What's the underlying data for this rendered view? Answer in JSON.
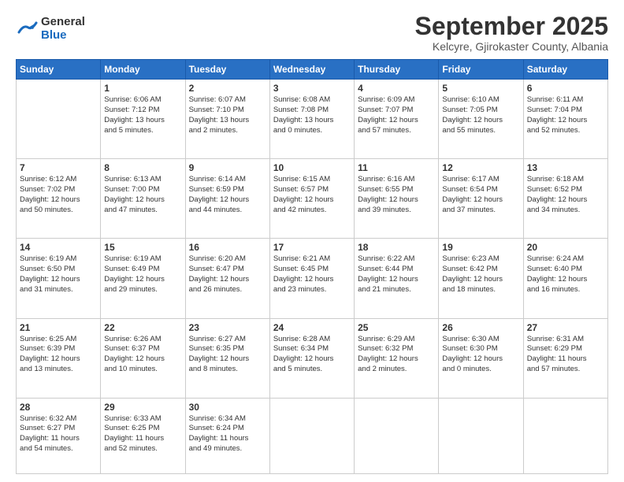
{
  "logo": {
    "general": "General",
    "blue": "Blue"
  },
  "header": {
    "month": "September 2025",
    "location": "Kelcyre, Gjirokaster County, Albania"
  },
  "weekdays": [
    "Sunday",
    "Monday",
    "Tuesday",
    "Wednesday",
    "Thursday",
    "Friday",
    "Saturday"
  ],
  "weeks": [
    [
      {
        "day": "",
        "info": ""
      },
      {
        "day": "1",
        "info": "Sunrise: 6:06 AM\nSunset: 7:12 PM\nDaylight: 13 hours\nand 5 minutes."
      },
      {
        "day": "2",
        "info": "Sunrise: 6:07 AM\nSunset: 7:10 PM\nDaylight: 13 hours\nand 2 minutes."
      },
      {
        "day": "3",
        "info": "Sunrise: 6:08 AM\nSunset: 7:08 PM\nDaylight: 13 hours\nand 0 minutes."
      },
      {
        "day": "4",
        "info": "Sunrise: 6:09 AM\nSunset: 7:07 PM\nDaylight: 12 hours\nand 57 minutes."
      },
      {
        "day": "5",
        "info": "Sunrise: 6:10 AM\nSunset: 7:05 PM\nDaylight: 12 hours\nand 55 minutes."
      },
      {
        "day": "6",
        "info": "Sunrise: 6:11 AM\nSunset: 7:04 PM\nDaylight: 12 hours\nand 52 minutes."
      }
    ],
    [
      {
        "day": "7",
        "info": "Sunrise: 6:12 AM\nSunset: 7:02 PM\nDaylight: 12 hours\nand 50 minutes."
      },
      {
        "day": "8",
        "info": "Sunrise: 6:13 AM\nSunset: 7:00 PM\nDaylight: 12 hours\nand 47 minutes."
      },
      {
        "day": "9",
        "info": "Sunrise: 6:14 AM\nSunset: 6:59 PM\nDaylight: 12 hours\nand 44 minutes."
      },
      {
        "day": "10",
        "info": "Sunrise: 6:15 AM\nSunset: 6:57 PM\nDaylight: 12 hours\nand 42 minutes."
      },
      {
        "day": "11",
        "info": "Sunrise: 6:16 AM\nSunset: 6:55 PM\nDaylight: 12 hours\nand 39 minutes."
      },
      {
        "day": "12",
        "info": "Sunrise: 6:17 AM\nSunset: 6:54 PM\nDaylight: 12 hours\nand 37 minutes."
      },
      {
        "day": "13",
        "info": "Sunrise: 6:18 AM\nSunset: 6:52 PM\nDaylight: 12 hours\nand 34 minutes."
      }
    ],
    [
      {
        "day": "14",
        "info": "Sunrise: 6:19 AM\nSunset: 6:50 PM\nDaylight: 12 hours\nand 31 minutes."
      },
      {
        "day": "15",
        "info": "Sunrise: 6:19 AM\nSunset: 6:49 PM\nDaylight: 12 hours\nand 29 minutes."
      },
      {
        "day": "16",
        "info": "Sunrise: 6:20 AM\nSunset: 6:47 PM\nDaylight: 12 hours\nand 26 minutes."
      },
      {
        "day": "17",
        "info": "Sunrise: 6:21 AM\nSunset: 6:45 PM\nDaylight: 12 hours\nand 23 minutes."
      },
      {
        "day": "18",
        "info": "Sunrise: 6:22 AM\nSunset: 6:44 PM\nDaylight: 12 hours\nand 21 minutes."
      },
      {
        "day": "19",
        "info": "Sunrise: 6:23 AM\nSunset: 6:42 PM\nDaylight: 12 hours\nand 18 minutes."
      },
      {
        "day": "20",
        "info": "Sunrise: 6:24 AM\nSunset: 6:40 PM\nDaylight: 12 hours\nand 16 minutes."
      }
    ],
    [
      {
        "day": "21",
        "info": "Sunrise: 6:25 AM\nSunset: 6:39 PM\nDaylight: 12 hours\nand 13 minutes."
      },
      {
        "day": "22",
        "info": "Sunrise: 6:26 AM\nSunset: 6:37 PM\nDaylight: 12 hours\nand 10 minutes."
      },
      {
        "day": "23",
        "info": "Sunrise: 6:27 AM\nSunset: 6:35 PM\nDaylight: 12 hours\nand 8 minutes."
      },
      {
        "day": "24",
        "info": "Sunrise: 6:28 AM\nSunset: 6:34 PM\nDaylight: 12 hours\nand 5 minutes."
      },
      {
        "day": "25",
        "info": "Sunrise: 6:29 AM\nSunset: 6:32 PM\nDaylight: 12 hours\nand 2 minutes."
      },
      {
        "day": "26",
        "info": "Sunrise: 6:30 AM\nSunset: 6:30 PM\nDaylight: 12 hours\nand 0 minutes."
      },
      {
        "day": "27",
        "info": "Sunrise: 6:31 AM\nSunset: 6:29 PM\nDaylight: 11 hours\nand 57 minutes."
      }
    ],
    [
      {
        "day": "28",
        "info": "Sunrise: 6:32 AM\nSunset: 6:27 PM\nDaylight: 11 hours\nand 54 minutes."
      },
      {
        "day": "29",
        "info": "Sunrise: 6:33 AM\nSunset: 6:25 PM\nDaylight: 11 hours\nand 52 minutes."
      },
      {
        "day": "30",
        "info": "Sunrise: 6:34 AM\nSunset: 6:24 PM\nDaylight: 11 hours\nand 49 minutes."
      },
      {
        "day": "",
        "info": ""
      },
      {
        "day": "",
        "info": ""
      },
      {
        "day": "",
        "info": ""
      },
      {
        "day": "",
        "info": ""
      }
    ]
  ]
}
